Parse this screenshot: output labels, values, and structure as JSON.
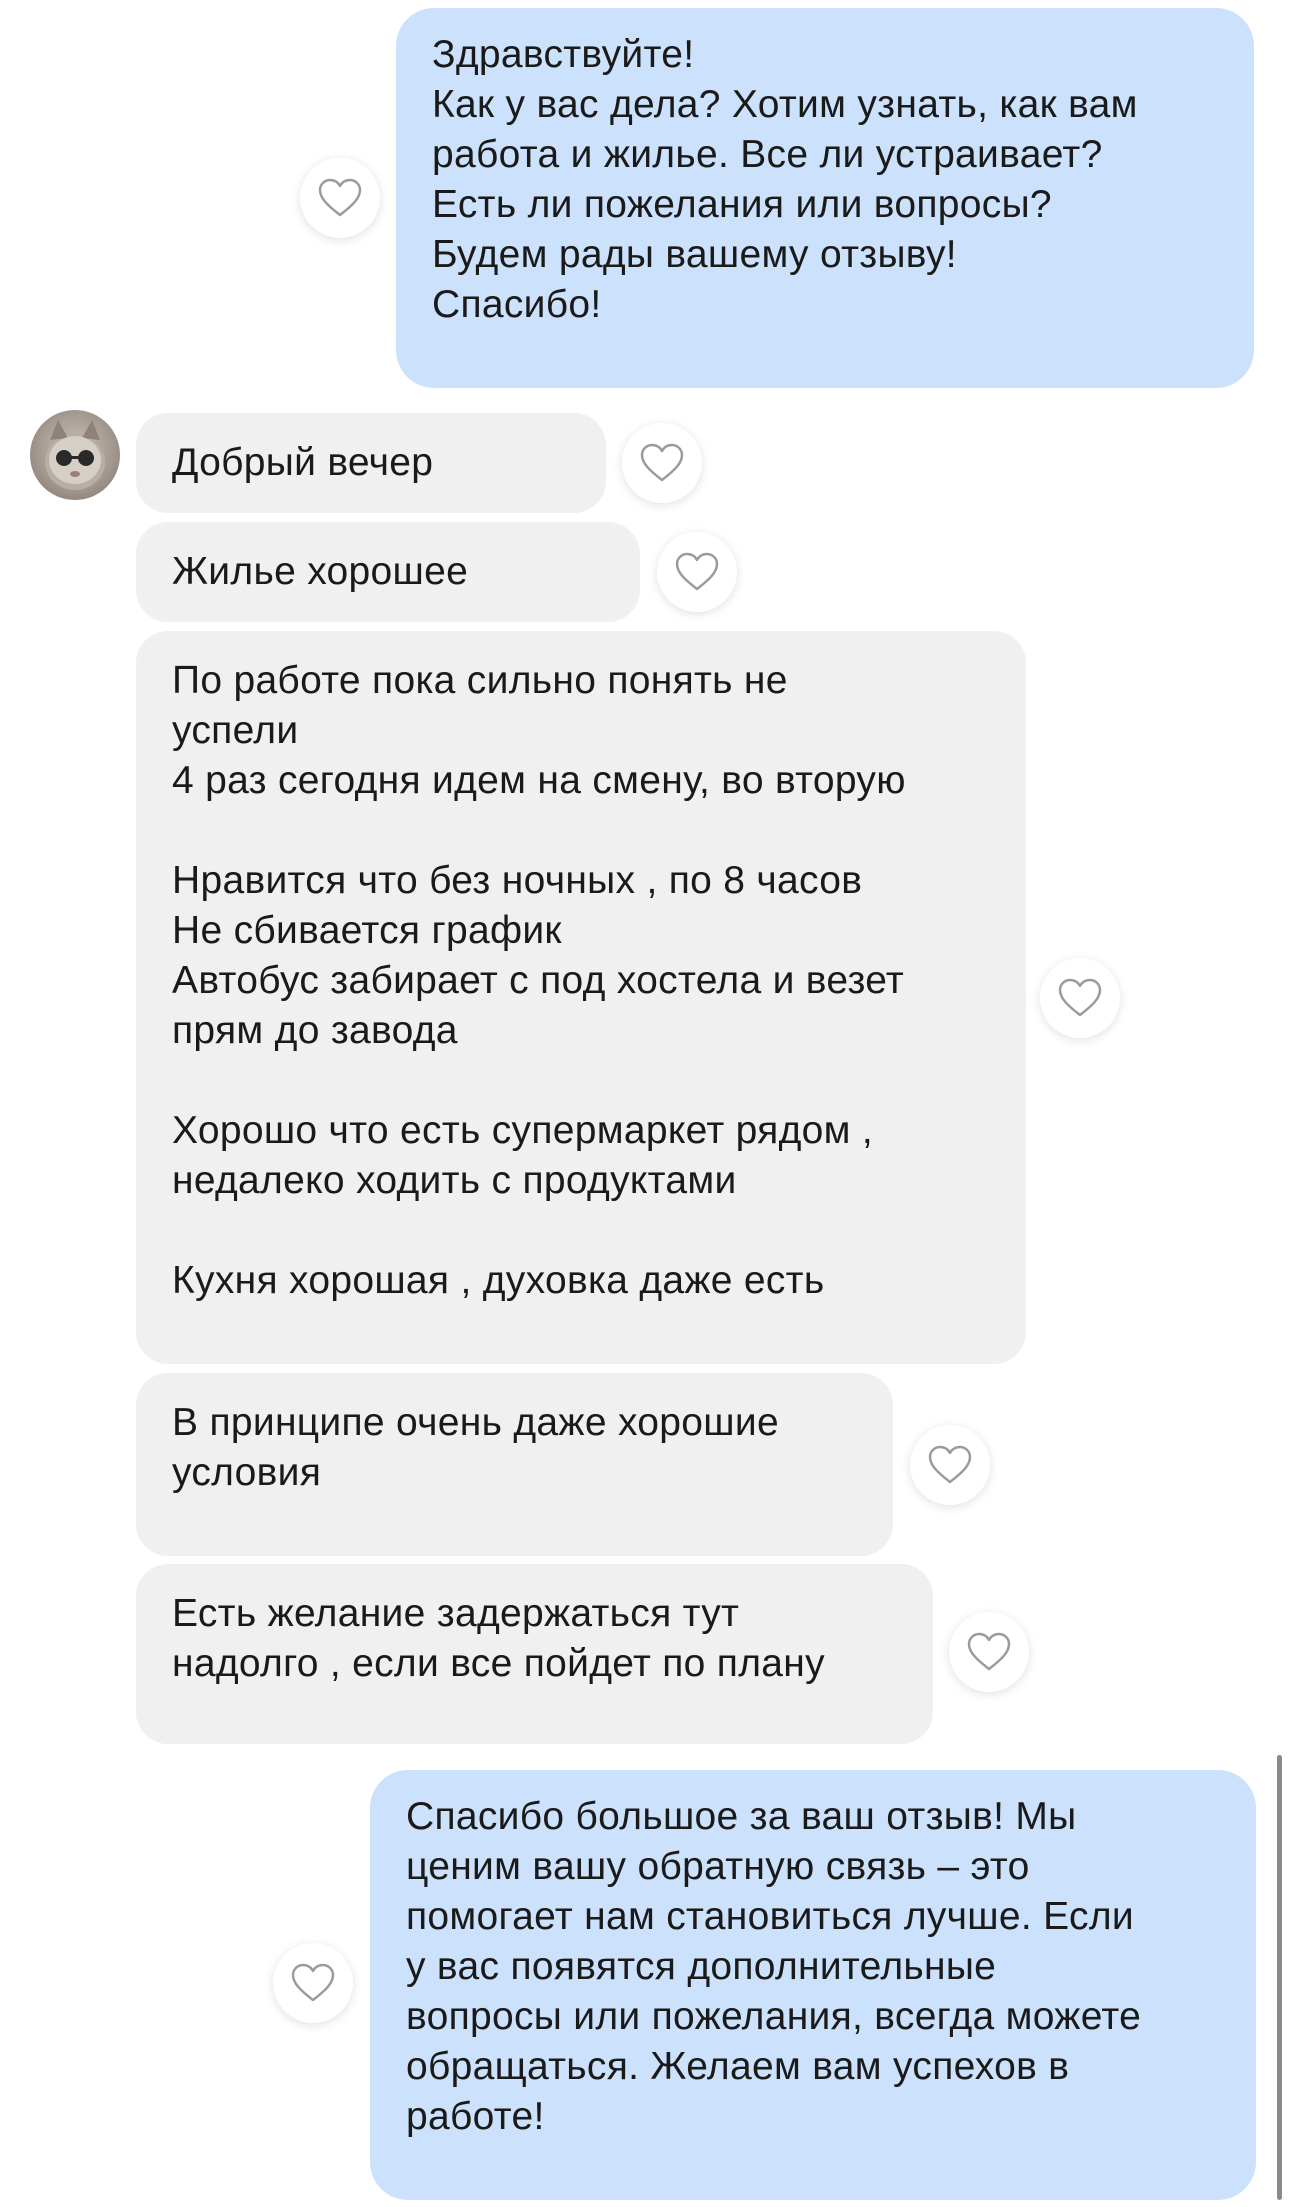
{
  "messages": [
    {
      "from": "me",
      "text": "Здравствуйте!\nКак у вас дела? Хотим узнать, как вам\nработа и жилье. Все ли устраивает?\nЕсть ли пожелания или вопросы?\nБудем рады вашему отзыву!\nСпасибо!"
    },
    {
      "from": "them",
      "text": "Добрый вечер"
    },
    {
      "from": "them",
      "text": "Жилье хорошее"
    },
    {
      "from": "them",
      "text": "По работе пока сильно понять не\nуспели\n4 раз сегодня идем на смену, во вторую\n\nНравится что без ночных , по 8 часов\nНе сбивается график\nАвтобус забирает с под хостела и везет\nпрям до завода\n\nХорошо что есть супермаркет рядом ,\nнедалеко ходить с продуктами\n\nКухня хорошая , духовка даже есть"
    },
    {
      "from": "them",
      "text": "В принципе очень даже хорошие\nусловия"
    },
    {
      "from": "them",
      "text": "Есть желание задержаться тут\nнадолго , если все пойдет по плану"
    },
    {
      "from": "me",
      "text": "Спасибо большое за ваш отзыв! Мы\nценим вашу обратную связь – это\nпомогает нам становиться лучше. Если\nу вас появятся дополнительные\nвопросы или пожелания, всегда можете\nобращаться. Желаем вам успехов в\nработе!"
    }
  ],
  "icons": {
    "like": "heart-outline-icon",
    "avatar": "cat-with-sunglasses-avatar"
  },
  "colors": {
    "outgoing_bubble": "#cce1fb",
    "incoming_bubble": "#f0f0f0",
    "text": "#1a1a1a",
    "heart_stroke": "#9b9b9b"
  }
}
